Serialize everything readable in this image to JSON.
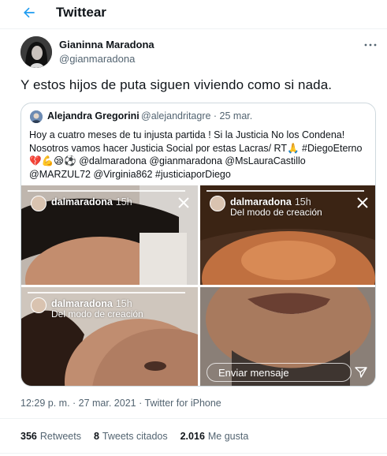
{
  "header": {
    "title": "Twittear"
  },
  "tweet": {
    "author_name": "Gianinna Maradona",
    "author_handle": "@gianmaradona",
    "text": "Y estos hijos de puta siguen viviendo como si nada."
  },
  "quote": {
    "author_name": "Alejandra Gregorini",
    "author_handle": "@alejandritagre",
    "date": "· 25 mar.",
    "lines": [
      "Hoy a cuatro meses de tu injusta partida ! Si la Justicia No los Condena!",
      "Nosotros vamos hacer Justicia Social por estas Lacras/ RT🙏 #DiegoEterno",
      "💔💪😪⚽ @dalmaradona @gianmaradona @MsLauraCastillo",
      "@MARZUL72 @Virginia862 #justiciaporDiego"
    ],
    "images": [
      {
        "user": "dalmaradona",
        "time": "15h",
        "subtitle": ""
      },
      {
        "user": "dalmaradona",
        "time": "15h",
        "subtitle": "Del modo de creación"
      },
      {
        "user": "dalmaradona",
        "time": "15h",
        "subtitle": "Del modo de creación"
      },
      {
        "message_placeholder": "Enviar mensaje"
      }
    ]
  },
  "meta": {
    "timestamp": "12:29 p. m. · 27 mar. 2021 · Twitter for iPhone"
  },
  "stats": {
    "retweets_count": "356",
    "retweets_label": "Retweets",
    "quotes_count": "8",
    "quotes_label": "Tweets citados",
    "likes_count": "2.016",
    "likes_label": "Me gusta"
  },
  "colors": {
    "accent": "#1d9bf0",
    "text": "#0f1419",
    "secondary": "#536471",
    "border": "#cfd9de"
  },
  "icons": {
    "back": "arrow-left-icon",
    "more": "more-horizontal-icon",
    "close": "close-icon",
    "send": "send-icon"
  }
}
